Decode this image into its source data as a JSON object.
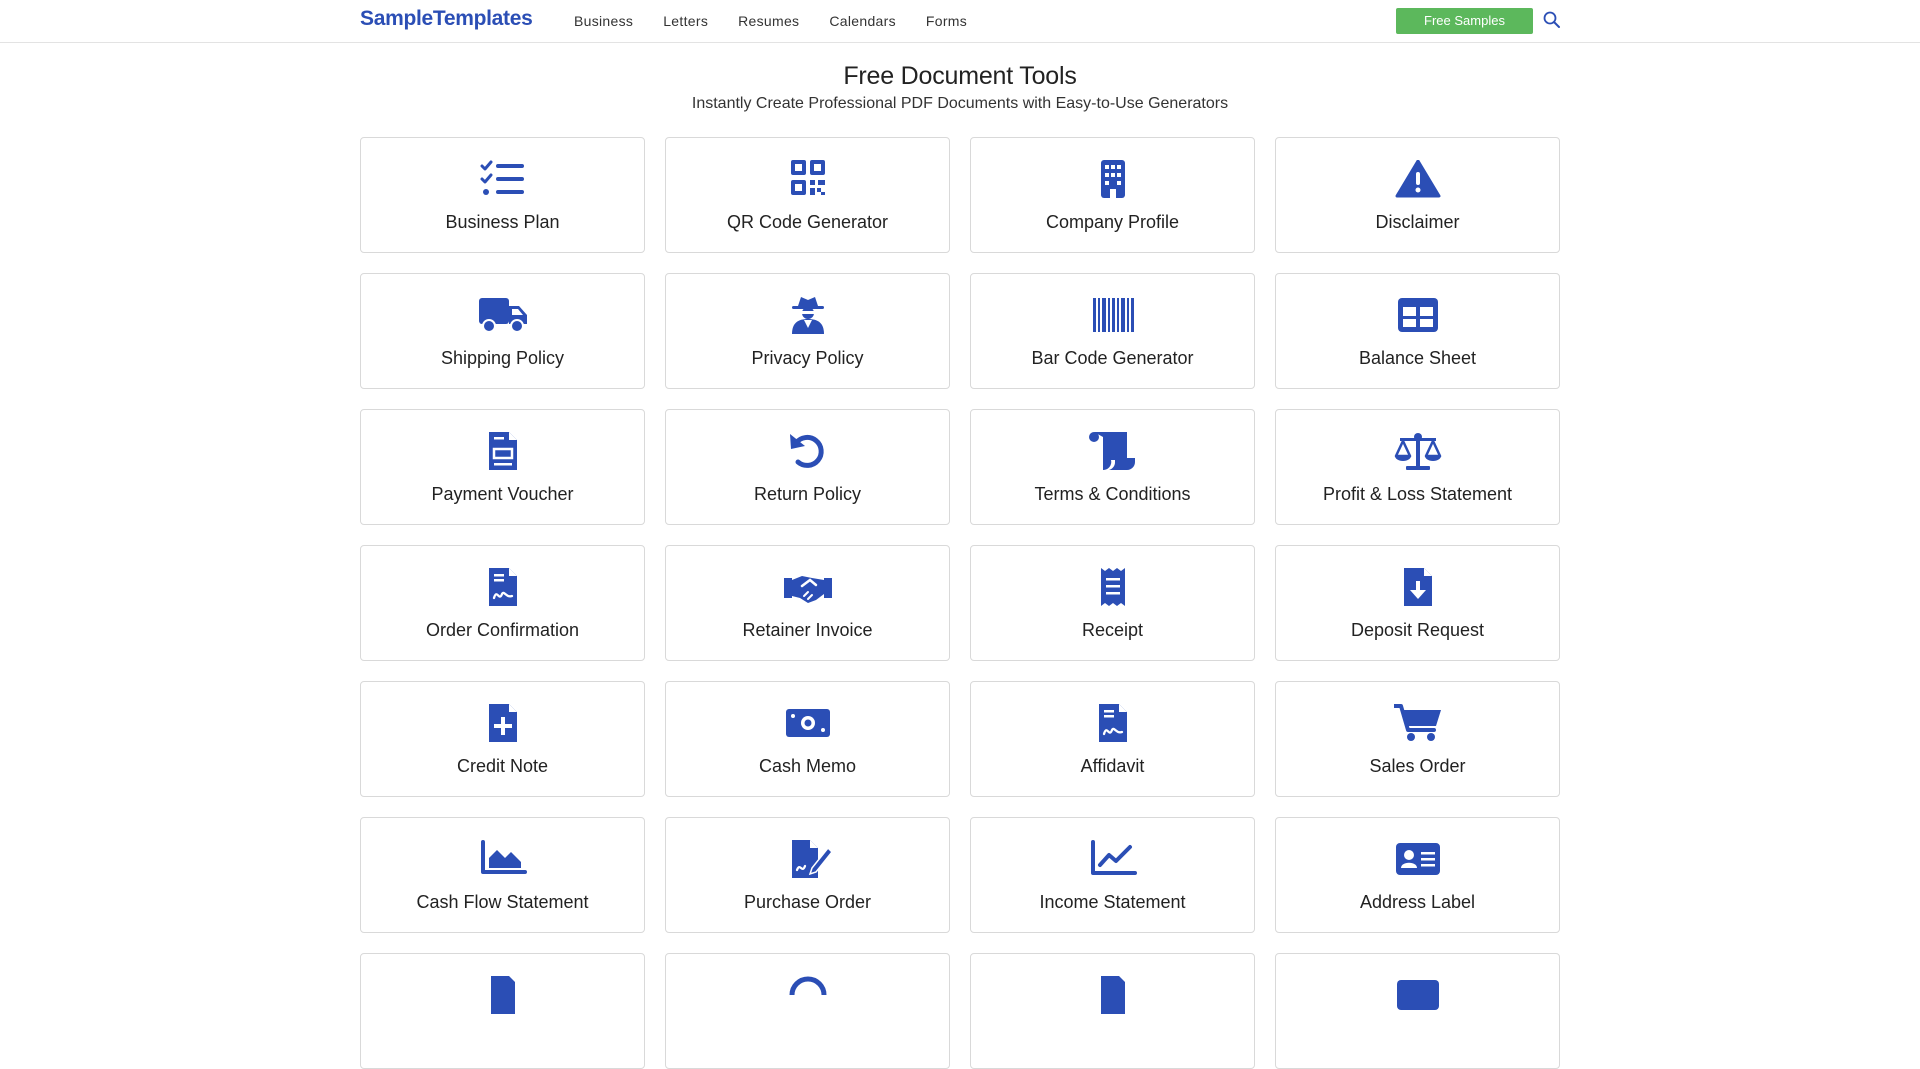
{
  "header": {
    "logo": "SampleTemplates",
    "nav": [
      "Business",
      "Letters",
      "Resumes",
      "Calendars",
      "Forms"
    ],
    "cta": "Free Samples",
    "search_icon": "search-icon"
  },
  "hero": {
    "title": "Free Document Tools",
    "subtitle": "Instantly Create Professional PDF Documents with Easy-to-Use Generators"
  },
  "colors": {
    "brand": "#2b4eb5",
    "cta": "#5cb85c"
  },
  "tools": [
    {
      "label": "Business Plan",
      "icon": "list-check-icon"
    },
    {
      "label": "QR Code Generator",
      "icon": "qrcode-icon"
    },
    {
      "label": "Company Profile",
      "icon": "building-icon"
    },
    {
      "label": "Disclaimer",
      "icon": "warning-icon"
    },
    {
      "label": "Shipping Policy",
      "icon": "truck-icon"
    },
    {
      "label": "Privacy Policy",
      "icon": "user-secret-icon"
    },
    {
      "label": "Bar Code Generator",
      "icon": "barcode-icon"
    },
    {
      "label": "Balance Sheet",
      "icon": "table-icon"
    },
    {
      "label": "Payment Voucher",
      "icon": "file-invoice-icon"
    },
    {
      "label": "Return Policy",
      "icon": "rotate-left-icon"
    },
    {
      "label": "Terms & Conditions",
      "icon": "scroll-icon"
    },
    {
      "label": "Profit & Loss Statement",
      "icon": "scale-icon"
    },
    {
      "label": "Order Confirmation",
      "icon": "file-signature-icon"
    },
    {
      "label": "Retainer Invoice",
      "icon": "handshake-icon"
    },
    {
      "label": "Receipt",
      "icon": "receipt-icon"
    },
    {
      "label": "Deposit Request",
      "icon": "file-download-icon"
    },
    {
      "label": "Credit Note",
      "icon": "file-plus-icon"
    },
    {
      "label": "Cash Memo",
      "icon": "money-bill-icon"
    },
    {
      "label": "Affidavit",
      "icon": "file-signature-icon"
    },
    {
      "label": "Sales Order",
      "icon": "cart-icon"
    },
    {
      "label": "Cash Flow Statement",
      "icon": "chart-area-icon"
    },
    {
      "label": "Purchase Order",
      "icon": "file-pen-icon"
    },
    {
      "label": "Income Statement",
      "icon": "chart-line-icon"
    },
    {
      "label": "Address Label",
      "icon": "address-card-icon"
    },
    {
      "label": "",
      "icon": "file-icon"
    },
    {
      "label": "",
      "icon": "circle-icon"
    },
    {
      "label": "",
      "icon": "file-icon"
    },
    {
      "label": "",
      "icon": "card-icon"
    }
  ]
}
